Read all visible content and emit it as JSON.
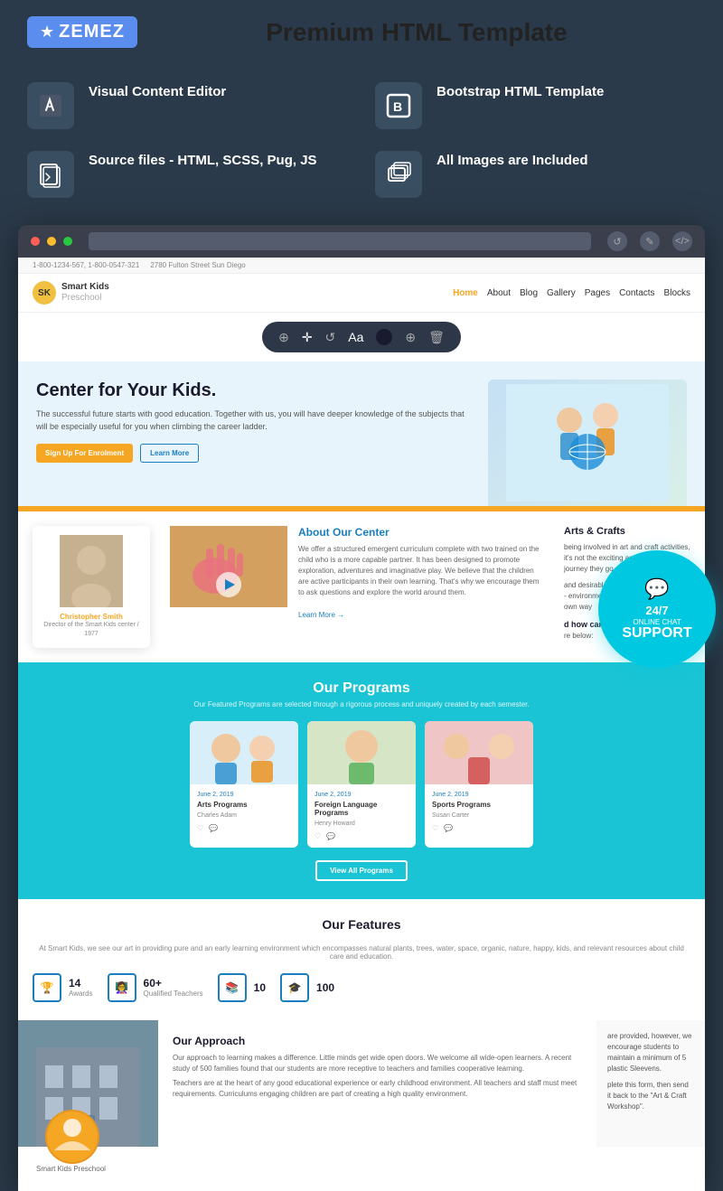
{
  "brand": {
    "logo_text": "ZEMEZ",
    "logo_icon": "★"
  },
  "header": {
    "title": "Premium HTML Template"
  },
  "features": [
    {
      "id": "visual-editor",
      "icon": "pencil",
      "label": "Visual Content Editor"
    },
    {
      "id": "bootstrap",
      "icon": "B",
      "label": "Bootstrap HTML Template"
    },
    {
      "id": "source-files",
      "icon": "code",
      "label": "Source files - HTML, SCSS, Pug, JS"
    },
    {
      "id": "images",
      "icon": "images",
      "label": "All Images are Included"
    }
  ],
  "site": {
    "name": "Smart Kids",
    "tagline": "Preschool",
    "nav_links": [
      "Home",
      "About",
      "Blog",
      "Gallery",
      "Pages",
      "Contacts",
      "Blocks"
    ],
    "hero_title": "Center for Your Kids.",
    "hero_text": "The successful future starts with good education. Together with us, you will have deeper knowledge of the subjects that will be especially useful for you when climbing the career ladder.",
    "hero_btn1": "Sign Up For Enrolment",
    "hero_btn2": "Learn More",
    "about_title": "About Our Center",
    "about_text": "We offer a structured emergent curriculum complete with two trained on the child who is a more capable partner. It has been designed to promote exploration, adventures and imaginative play. We believe that the children are active participants in their own learning. That's why we encourage them to ask questions and explore the world around them.",
    "about_link": "Learn More →",
    "programs_title": "Our Programs",
    "programs_subtitle": "Our Featured Programs are selected through a rigorous process and uniquely created by each semester.",
    "programs": [
      {
        "date": "June 2, 2019",
        "name": "Arts Programs",
        "author": "Charles Adam"
      },
      {
        "date": "June 2, 2019",
        "name": "Foreign Language Programs",
        "author": "Henry Howard"
      },
      {
        "date": "June 2, 2019",
        "name": "Sports Programs",
        "author": "Susan Carter"
      }
    ],
    "view_all_btn": "View All Programs",
    "features_title": "Our Features",
    "features_sub": "At Smart Kids, we see our art in providing pure and an early learning environment which encompasses natural plants, trees, water, space, organic, nature, happy, kids, and relevant resources about child care and education.",
    "stats": [
      {
        "num": "14",
        "label": "Awards"
      },
      {
        "num": "60+",
        "label": "Qualified Teachers"
      },
      {
        "num": "10",
        "label": ""
      },
      {
        "num": "100",
        "label": ""
      }
    ],
    "profile_name": "Christopher Smith",
    "profile_role": "Director of the Smart Kids center / 1977",
    "craft_title": "Arts & Crafts",
    "craft_text": "being involved in art and craft activities, it's not the exciting and absorbing journey they go on.\n\nand desirable life skills, and the best bit - environment, they engage in their own way\n\nd how can my child apply?\nre below:",
    "approach_title": "Our Approach",
    "approach_text": "Our approach to learning makes a difference..."
  },
  "chat_badge": {
    "hours": "24/7",
    "line1": "ONLINE CHAT",
    "support": "SUPPORT",
    "icon": "💬"
  },
  "edit_toolbar": {
    "tools": [
      "⊕",
      "✛",
      "↺",
      "Aa",
      "⊕",
      "🗑"
    ]
  }
}
